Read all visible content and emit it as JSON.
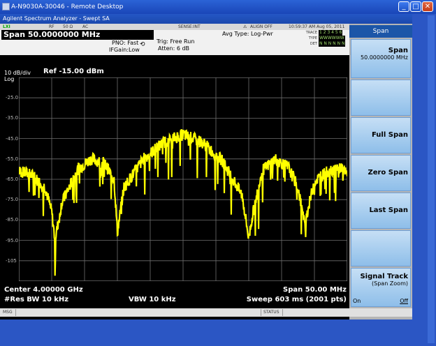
{
  "window": {
    "title": "A-N9030A-30046 - Remote Desktop",
    "app_title": "Agilent Spectrum Analyzer - Swept SA"
  },
  "statusbar": {
    "lxi": "LXI",
    "rf": "RF",
    "impedance": "50 Ω",
    "coupling": "AC",
    "sense": "SENSE:INT",
    "align": "ALIGN OFF",
    "datetime": "10:59:37 AM Aug 05, 2011"
  },
  "info": {
    "span": "Span  50.0000000 MHz",
    "pno": "PNO: Fast",
    "ifgain": "IFGain:Low",
    "trig": "Trig: Free Run",
    "atten": "Atten: 6 dB",
    "avg_type": "Avg Type: Log-Pwr",
    "trace_label": "TRACE",
    "trace_value": "1 2 3 4 5 6",
    "type_label": "TYPE",
    "type_value": "WWWWWW",
    "det_label": "DET",
    "det_value": "N N N N N N"
  },
  "plot": {
    "scale": "10 dB/div",
    "scale_type": "Log",
    "ref": "Ref -15.00 dBm",
    "y_labels": [
      "-25.0",
      "-35.0",
      "-45.0",
      "-55.0",
      "-65.0",
      "-75.0",
      "-85.0",
      "-95.0",
      "-105"
    ],
    "trace_color": "#ffff00",
    "grid_color": "#6e6e6e"
  },
  "chart_data": {
    "type": "line",
    "title": "",
    "xlabel": "",
    "ylabel": "",
    "x_center_ghz": 4.0,
    "x_span_mhz": 50.0,
    "x_range_mhz": [
      -25,
      25
    ],
    "ylim": [
      -115,
      -15
    ],
    "y_unit": "dBm",
    "grid": true,
    "series": [
      {
        "x": [
          -25,
          -23,
          -21,
          -20,
          -19.5,
          -18.5,
          -16,
          -14,
          -12,
          -10.5,
          -10,
          -9,
          -6,
          -3,
          0,
          3,
          6,
          9,
          10,
          10.5,
          12,
          14,
          16,
          17.5,
          18.5,
          20,
          22,
          24,
          25
        ],
        "values": [
          -62,
          -64,
          -70,
          -82,
          -96,
          -78,
          -61,
          -56,
          -58,
          -66,
          -92,
          -70,
          -56,
          -48,
          -44,
          -48,
          -57,
          -74,
          -95,
          -85,
          -62,
          -56,
          -60,
          -70,
          -88,
          -67,
          -62,
          -60,
          -64
        ]
      }
    ]
  },
  "footer": {
    "center": "Center 4.00000 GHz",
    "rbw": "#Res BW 10 kHz",
    "vbw": "VBW 10 kHz",
    "span": "Span 50.00 MHz",
    "sweep": "Sweep  603 ms (2001 pts)"
  },
  "softkeys": {
    "menu_title": "Span",
    "span_label": "Span",
    "span_value": "50.0000000 MHz",
    "full_span": "Full Span",
    "zero_span": "Zero Span",
    "last_span": "Last Span",
    "signal_track": "Signal Track",
    "signal_track_sub": "(Span Zoom)",
    "on": "On",
    "off": "Off"
  },
  "msgbar": {
    "msg": "MSG",
    "status": "STATUS"
  }
}
